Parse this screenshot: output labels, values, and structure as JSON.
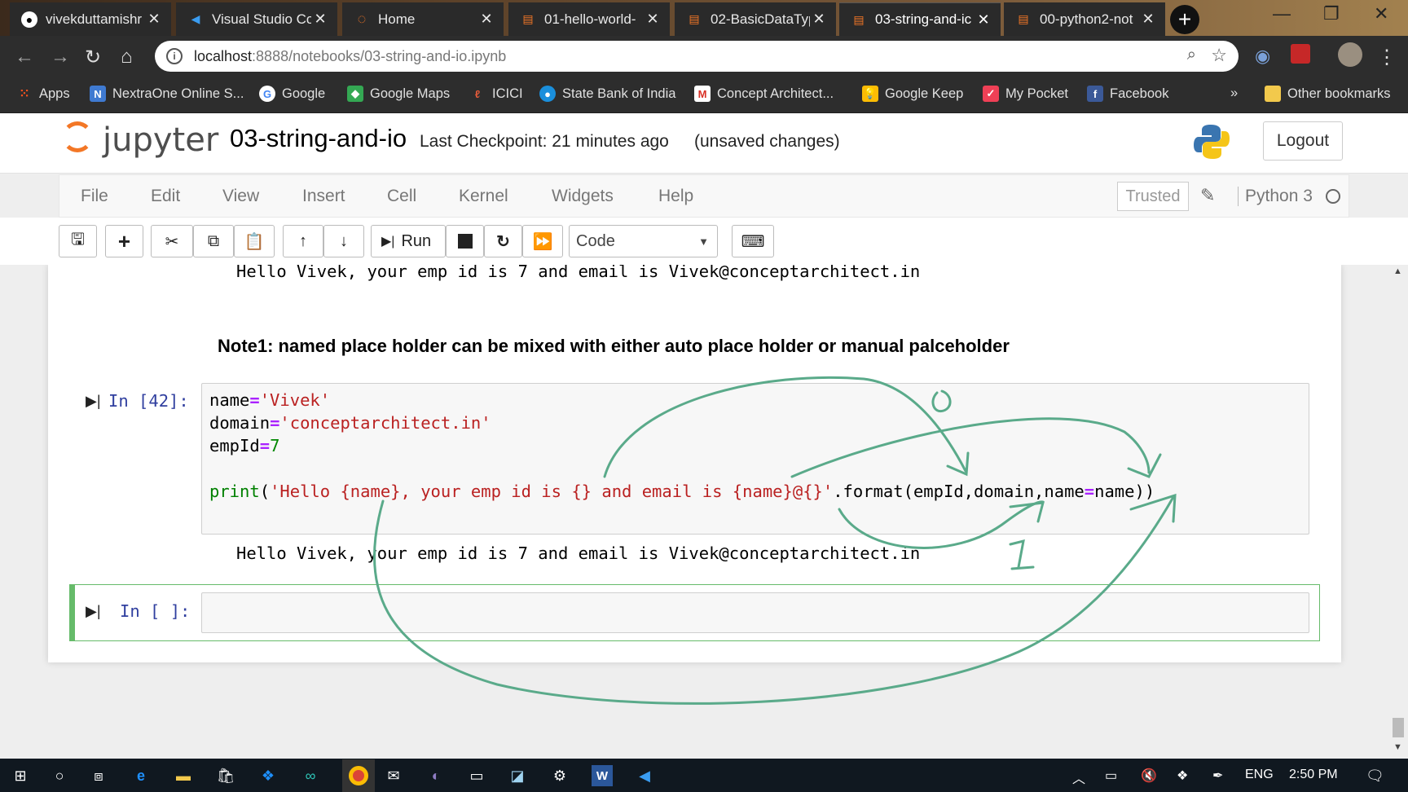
{
  "browser": {
    "tabs": [
      {
        "title": "vivekduttamishr",
        "icon": "github-icon"
      },
      {
        "title": "Visual Studio Co",
        "icon": "vscode-icon"
      },
      {
        "title": "Home",
        "icon": "jupyter-icon"
      },
      {
        "title": "01-hello-world-",
        "icon": "notebook-icon"
      },
      {
        "title": "02-BasicDataTyp",
        "icon": "notebook-icon"
      },
      {
        "title": "03-string-and-ic",
        "icon": "notebook-icon"
      },
      {
        "title": "00-python2-not",
        "icon": "notebook-icon"
      }
    ],
    "url_host": "localhost",
    "url_path": ":8888/notebooks/03-string-and-io.ipynb",
    "bookmarks": [
      {
        "label": "Apps",
        "icon": "apps-grid-icon"
      },
      {
        "label": "NextraOne Online S...",
        "icon": "nextraone-icon"
      },
      {
        "label": "Google",
        "icon": "google-icon"
      },
      {
        "label": "Google Maps",
        "icon": "maps-icon"
      },
      {
        "label": "ICICI",
        "icon": "icici-icon"
      },
      {
        "label": "State Bank of India",
        "icon": "sbi-icon"
      },
      {
        "label": "Concept Architect...",
        "icon": "gmail-icon"
      },
      {
        "label": "Google Keep",
        "icon": "keep-icon"
      },
      {
        "label": "My Pocket",
        "icon": "pocket-icon"
      },
      {
        "label": "Facebook",
        "icon": "facebook-icon"
      }
    ],
    "more_bookmarks": "»",
    "other_bookmarks": "Other bookmarks"
  },
  "jupyter": {
    "logo_text": "jupyter",
    "notebook_name": "03-string-and-io",
    "checkpoint": "Last Checkpoint: 21 minutes ago",
    "unsaved": "(unsaved changes)",
    "logout": "Logout",
    "menu": [
      "File",
      "Edit",
      "View",
      "Insert",
      "Cell",
      "Kernel",
      "Widgets",
      "Help"
    ],
    "trusted": "Trusted",
    "kernel": "Python 3",
    "run_label": "Run",
    "cell_type": "Code"
  },
  "notebook": {
    "prev_output": "Hello Vivek, your emp id is 7 and email is Vivek@conceptarchitect.in",
    "note": "Note1: named place holder can be mixed with either auto place holder or manual palceholder",
    "cell_prompt": "In [42]:",
    "code_lines": {
      "l1a": "name",
      "l1b": "=",
      "l1c": "'Vivek'",
      "l2a": "domain",
      "l2b": "=",
      "l2c": "'conceptarchitect.in'",
      "l3a": "empId",
      "l3b": "=",
      "l3c": "7",
      "l5a": "print",
      "l5b": "(",
      "l5c": "'Hello {name}, your emp id is {} and email is {name}@{}'",
      "l5d": ".format(empId,domain,name",
      "l5e": "=",
      "l5f": "name))"
    },
    "cell_output": "Hello Vivek, your emp id is 7 and email is Vivek@conceptarchitect.in",
    "empty_prompt": "In [ ]:",
    "annotation_labels": [
      "0",
      "1"
    ]
  },
  "taskbar": {
    "language": "ENG",
    "time": "2:50 PM"
  },
  "colors": {
    "jupyter_orange": "#f37726",
    "prompt_blue": "#303f9f",
    "string_red": "#ba2121",
    "keyword_green": "#008000",
    "annotation_green": "#5aaa8a",
    "selected_cell_green": "#66bb6a"
  }
}
